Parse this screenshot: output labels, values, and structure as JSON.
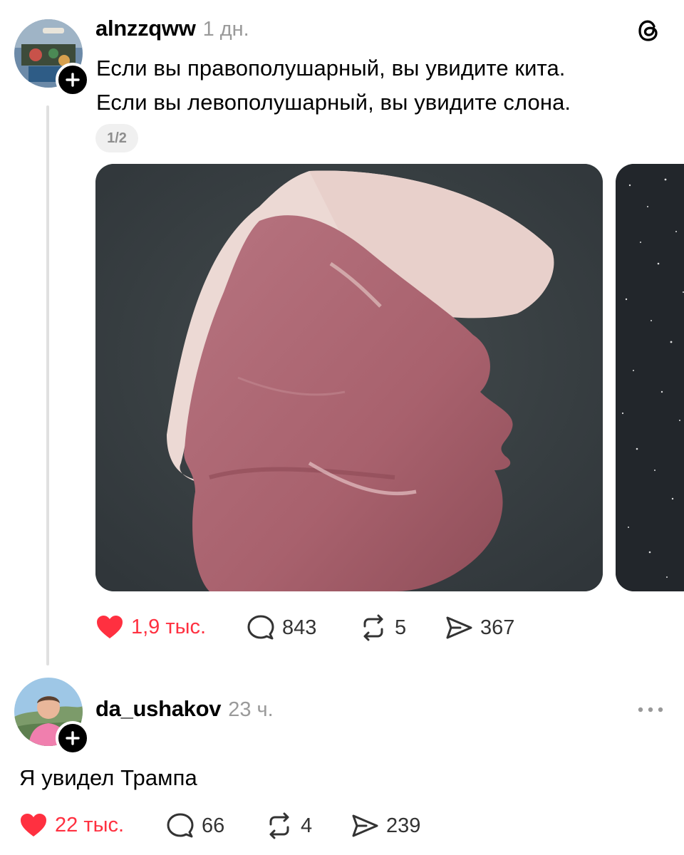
{
  "post": {
    "username": "alnzzqww",
    "time": "1 дн.",
    "text_line1": "Если вы правополушарный, вы увидите кита.",
    "text_line2": "Если вы левополушарный, вы увидите слона.",
    "media_counter": "1/2",
    "likes": "1,9 тыс.",
    "replies": "843",
    "reposts": "5",
    "shares": "367"
  },
  "reply": {
    "username": "da_ushakov",
    "time": "23 ч.",
    "text": "Я увидел Трампа",
    "likes": "22 тыс.",
    "replies": "66",
    "reposts": "4",
    "shares": "239"
  },
  "icons": {
    "app_logo": "threads-logo-icon",
    "like": "heart-icon",
    "reply": "comment-icon",
    "repost": "repost-icon",
    "share": "share-icon",
    "more": "more-icon",
    "follow": "plus-icon"
  },
  "colors": {
    "like_active": "#ff3040",
    "muted_text": "#9a9a9a",
    "media_background": "#3a4042",
    "meat": "#b06a74",
    "fat": "#ecd9d4"
  }
}
